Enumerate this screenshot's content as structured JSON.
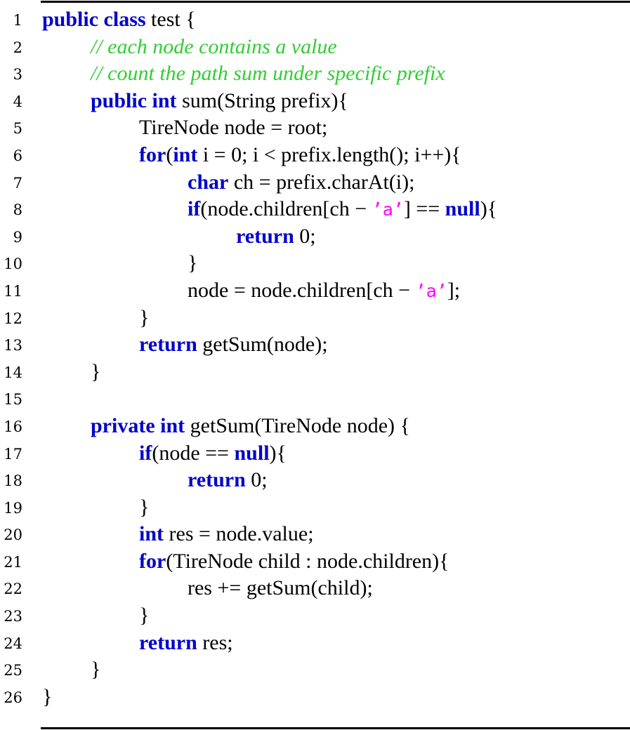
{
  "title": "",
  "colors": {
    "keyword": "#0000cc",
    "comment": "#33cc33",
    "string": "#ff00ff",
    "text": "#000000",
    "rule": "#000000"
  },
  "listing": {
    "lines": [
      {
        "n": "1",
        "indent": 0,
        "tokens": [
          {
            "t": "kw",
            "v": "public class"
          },
          {
            "t": "tx",
            "v": " test {"
          }
        ]
      },
      {
        "n": "2",
        "indent": 1,
        "tokens": [
          {
            "t": "cm",
            "v": "// each node contains a value"
          }
        ]
      },
      {
        "n": "3",
        "indent": 1,
        "tokens": [
          {
            "t": "cm",
            "v": "// count the path sum under specific prefix"
          }
        ]
      },
      {
        "n": "4",
        "indent": 1,
        "tokens": [
          {
            "t": "kw",
            "v": "public int"
          },
          {
            "t": "tx",
            "v": " sum(String prefix){"
          }
        ]
      },
      {
        "n": "5",
        "indent": 2,
        "tokens": [
          {
            "t": "tx",
            "v": "TireNode node = root;"
          }
        ]
      },
      {
        "n": "6",
        "indent": 2,
        "tokens": [
          {
            "t": "kw",
            "v": "for"
          },
          {
            "t": "tx",
            "v": "("
          },
          {
            "t": "kw",
            "v": "int"
          },
          {
            "t": "tx",
            "v": " i = 0; i < prefix.length(); i++){"
          }
        ]
      },
      {
        "n": "7",
        "indent": 3,
        "tokens": [
          {
            "t": "kw",
            "v": "char"
          },
          {
            "t": "tx",
            "v": " ch = prefix.charAt(i);"
          }
        ]
      },
      {
        "n": "8",
        "indent": 3,
        "tokens": [
          {
            "t": "kw",
            "v": "if"
          },
          {
            "t": "tx",
            "v": "(node.children[ch − "
          },
          {
            "t": "str",
            "v": "’a’"
          },
          {
            "t": "tx",
            "v": "] == "
          },
          {
            "t": "kw",
            "v": "null"
          },
          {
            "t": "tx",
            "v": "){"
          }
        ]
      },
      {
        "n": "9",
        "indent": 4,
        "tokens": [
          {
            "t": "kw",
            "v": "return"
          },
          {
            "t": "tx",
            "v": " 0;"
          }
        ]
      },
      {
        "n": "10",
        "indent": 3,
        "tokens": [
          {
            "t": "tx",
            "v": "}"
          }
        ]
      },
      {
        "n": "11",
        "indent": 3,
        "tokens": [
          {
            "t": "tx",
            "v": "node = node.children[ch − "
          },
          {
            "t": "str",
            "v": "’a’"
          },
          {
            "t": "tx",
            "v": "];"
          }
        ]
      },
      {
        "n": "12",
        "indent": 2,
        "tokens": [
          {
            "t": "tx",
            "v": "}"
          }
        ]
      },
      {
        "n": "13",
        "indent": 2,
        "tokens": [
          {
            "t": "kw",
            "v": "return"
          },
          {
            "t": "tx",
            "v": " getSum(node);"
          }
        ]
      },
      {
        "n": "14",
        "indent": 1,
        "tokens": [
          {
            "t": "tx",
            "v": "}"
          }
        ]
      },
      {
        "n": "15",
        "indent": 0,
        "tokens": []
      },
      {
        "n": "16",
        "indent": 1,
        "tokens": [
          {
            "t": "kw",
            "v": "private int"
          },
          {
            "t": "tx",
            "v": " getSum(TireNode node) {"
          }
        ]
      },
      {
        "n": "17",
        "indent": 2,
        "tokens": [
          {
            "t": "kw",
            "v": "if"
          },
          {
            "t": "tx",
            "v": "(node == "
          },
          {
            "t": "kw",
            "v": "null"
          },
          {
            "t": "tx",
            "v": "){"
          }
        ]
      },
      {
        "n": "18",
        "indent": 3,
        "tokens": [
          {
            "t": "kw",
            "v": "return"
          },
          {
            "t": "tx",
            "v": " 0;"
          }
        ]
      },
      {
        "n": "19",
        "indent": 2,
        "tokens": [
          {
            "t": "tx",
            "v": "}"
          }
        ]
      },
      {
        "n": "20",
        "indent": 2,
        "tokens": [
          {
            "t": "kw",
            "v": "int"
          },
          {
            "t": "tx",
            "v": " res = node.value;"
          }
        ]
      },
      {
        "n": "21",
        "indent": 2,
        "tokens": [
          {
            "t": "kw",
            "v": "for"
          },
          {
            "t": "tx",
            "v": "(TireNode child : node.children){"
          }
        ]
      },
      {
        "n": "22",
        "indent": 3,
        "tokens": [
          {
            "t": "tx",
            "v": "res += getSum(child);"
          }
        ]
      },
      {
        "n": "23",
        "indent": 2,
        "tokens": [
          {
            "t": "tx",
            "v": "}"
          }
        ]
      },
      {
        "n": "24",
        "indent": 2,
        "tokens": [
          {
            "t": "kw",
            "v": "return"
          },
          {
            "t": "tx",
            "v": " res;"
          }
        ]
      },
      {
        "n": "25",
        "indent": 1,
        "tokens": [
          {
            "t": "tx",
            "v": "}"
          }
        ]
      },
      {
        "n": "26",
        "indent": 0,
        "tokens": [
          {
            "t": "tx",
            "v": "}"
          }
        ]
      }
    ]
  }
}
